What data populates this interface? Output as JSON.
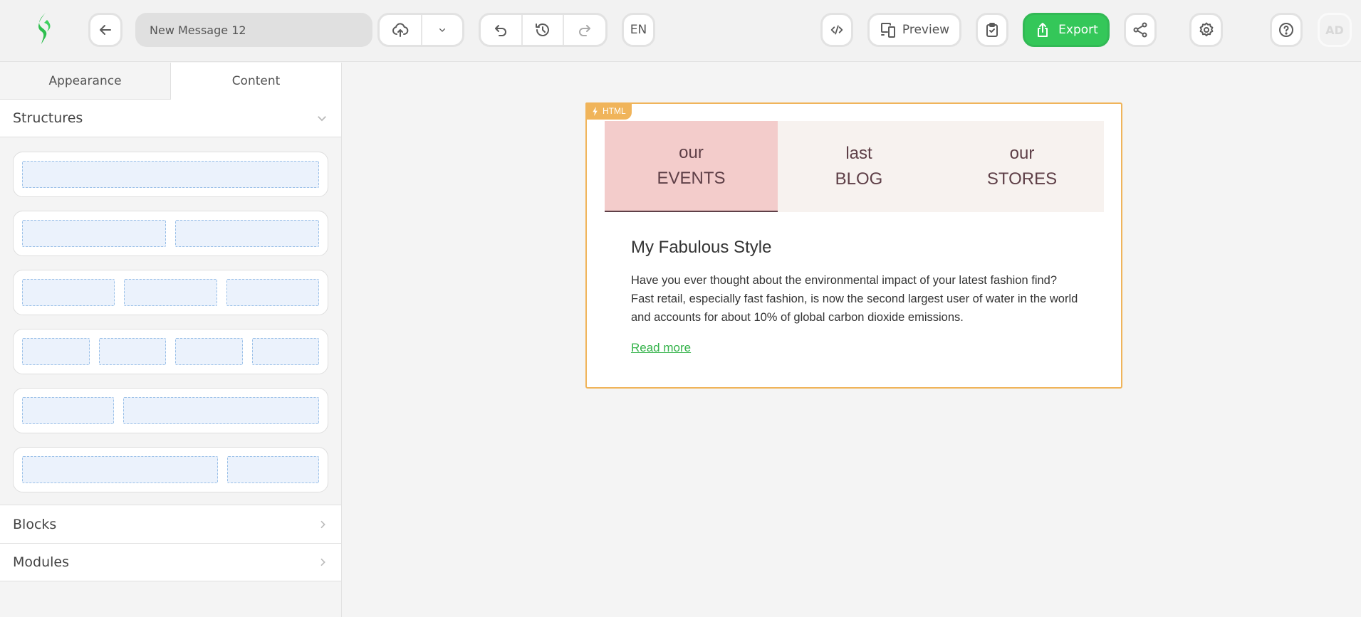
{
  "header": {
    "logo": "app-logo",
    "back_icon": "arrow-left-icon",
    "message_name": "New Message 12",
    "save_icon": "cloud-upload-icon",
    "save_menu_icon": "chevron-down-icon",
    "undo_icon": "undo-icon",
    "history_icon": "history-icon",
    "redo_icon": "redo-icon",
    "language": "EN",
    "code_label": "</>",
    "preview_label": "Preview",
    "test_icon": "clipboard-check-icon",
    "export_label": "Export",
    "share_icon": "share-icon",
    "settings_icon": "gear-icon",
    "help_icon": "help-icon",
    "avatar_initials": "AD"
  },
  "sidebar": {
    "tabs": [
      {
        "label": "Appearance",
        "active": false
      },
      {
        "label": "Content",
        "active": true
      }
    ],
    "structures_label": "Structures",
    "structures": [
      {
        "columns": [
          1
        ]
      },
      {
        "columns": [
          1,
          1
        ]
      },
      {
        "columns": [
          1,
          1,
          1
        ]
      },
      {
        "columns": [
          1,
          1,
          1,
          1
        ]
      },
      {
        "columns": [
          1,
          2
        ]
      },
      {
        "columns": [
          2,
          1
        ]
      }
    ],
    "sections": [
      {
        "label": "Blocks"
      },
      {
        "label": "Modules"
      }
    ]
  },
  "email": {
    "badge": "HTML",
    "tabs": [
      {
        "line1": "our",
        "line2": "EVENTS",
        "active": true
      },
      {
        "line1": "last",
        "line2": "BLOG",
        "active": false
      },
      {
        "line1": "our",
        "line2": "STORES",
        "active": false
      }
    ],
    "heading": "My Fabulous Style",
    "body": "Have you ever thought about the environmental impact of your latest fashion find? Fast retail, especially fast fashion, is now the second largest user of water in the world and accounts for about 10% of global carbon dioxide emissions.",
    "link": "Read more"
  },
  "colors": {
    "brand_green": "#34c759",
    "frame_highlight": "#f0b45a",
    "active_tab_bg": "#f3cccb",
    "tab_bg": "#f7f2ef",
    "tab_text": "#5e3f47",
    "link": "#34b34a"
  }
}
